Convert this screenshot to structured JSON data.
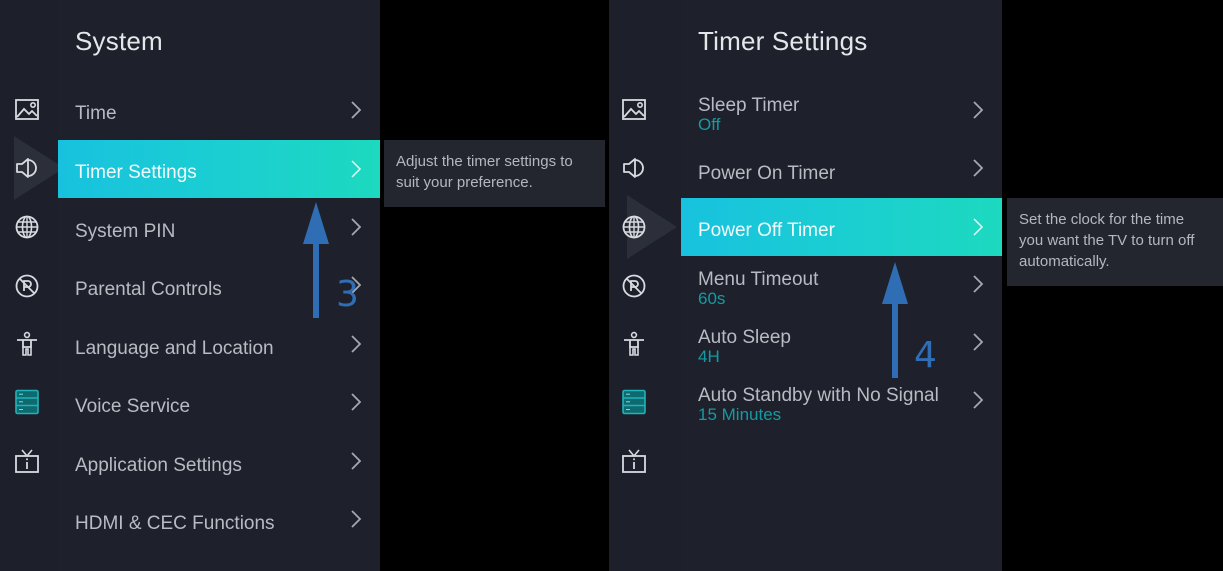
{
  "colors": {
    "accent": "#1ac3dd",
    "accent_end": "#1dd9bf",
    "value_text": "#159aa2",
    "panel_bg": "#1e212b",
    "sidebar_bg": "#1d202a",
    "annotation_blue": "#2f6db5"
  },
  "sidebar_icons": [
    {
      "name": "picture-icon",
      "active": false
    },
    {
      "name": "sound-icon",
      "active": false
    },
    {
      "name": "network-icon",
      "active": false
    },
    {
      "name": "parental-icon",
      "active": false
    },
    {
      "name": "accessibility-icon",
      "active": false
    },
    {
      "name": "system-icon",
      "active": true
    },
    {
      "name": "support-icon",
      "active": false
    }
  ],
  "left": {
    "title": "System",
    "focused_sidebar_icon": "sound-icon",
    "items": [
      {
        "label": "Time"
      },
      {
        "label": "Timer Settings",
        "selected": true
      },
      {
        "label": "System PIN"
      },
      {
        "label": "Parental Controls"
      },
      {
        "label": "Language and Location"
      },
      {
        "label": "Voice Service"
      },
      {
        "label": "Application Settings"
      },
      {
        "label": "HDMI & CEC Functions"
      }
    ],
    "tooltip": "Adjust the timer settings to suit your preference.",
    "annotation": "3"
  },
  "right": {
    "title": "Timer Settings",
    "focused_sidebar_icon": "network-icon",
    "items": [
      {
        "label": "Sleep Timer",
        "value": "Off"
      },
      {
        "label": "Power On Timer"
      },
      {
        "label": "Power Off Timer",
        "selected": true
      },
      {
        "label": "Menu Timeout",
        "value": "60s"
      },
      {
        "label": "Auto Sleep",
        "value": "4H"
      },
      {
        "label": "Auto Standby with No Signal",
        "value": "15 Minutes"
      }
    ],
    "tooltip": "Set the clock for the time you want the TV to turn off automatically.",
    "annotation": "4"
  }
}
